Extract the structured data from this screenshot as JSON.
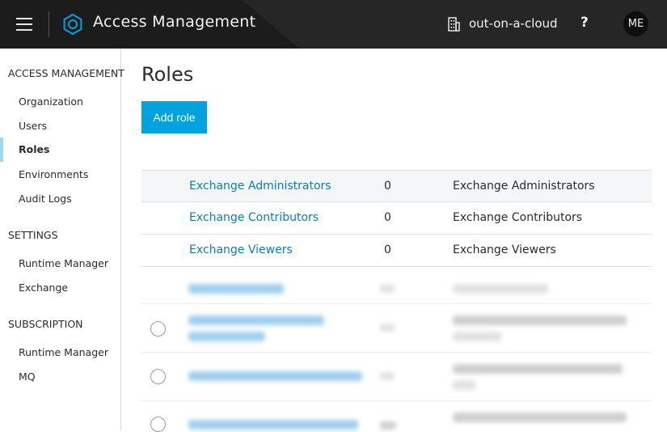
{
  "header": {
    "app_title": "Access Management",
    "org_name": "out-on-a-cloud",
    "help_label": "?",
    "avatar_initials": "ME",
    "icons": {
      "menu": "hamburger-menu-icon",
      "app": "gear-hexagon-icon",
      "org": "building-icon"
    }
  },
  "sidebar": {
    "sections": [
      {
        "title": "ACCESS MANAGEMENT",
        "items": [
          "Organization",
          "Users",
          "Roles",
          "Environments",
          "Audit Logs"
        ]
      },
      {
        "title": "SETTINGS",
        "items": [
          "Runtime Manager",
          "Exchange"
        ]
      },
      {
        "title": "SUBSCRIPTION",
        "items": [
          "Runtime Manager",
          "MQ"
        ]
      }
    ],
    "active_item": "Roles"
  },
  "main": {
    "title": "Roles",
    "add_button_label": "Add role",
    "rows": [
      {
        "name": "Exchange Administrators",
        "count": "0",
        "description": "Exchange Administrators"
      },
      {
        "name": "Exchange Contributors",
        "count": "0",
        "description": "Exchange Contributors"
      },
      {
        "name": "Exchange Viewers",
        "count": "0",
        "description": "Exchange Viewers"
      }
    ]
  },
  "colors": {
    "header_bg": "#262626",
    "accent": "#00a2df",
    "link": "#0c7cb8",
    "active_indicator": "#9fd8f0"
  }
}
